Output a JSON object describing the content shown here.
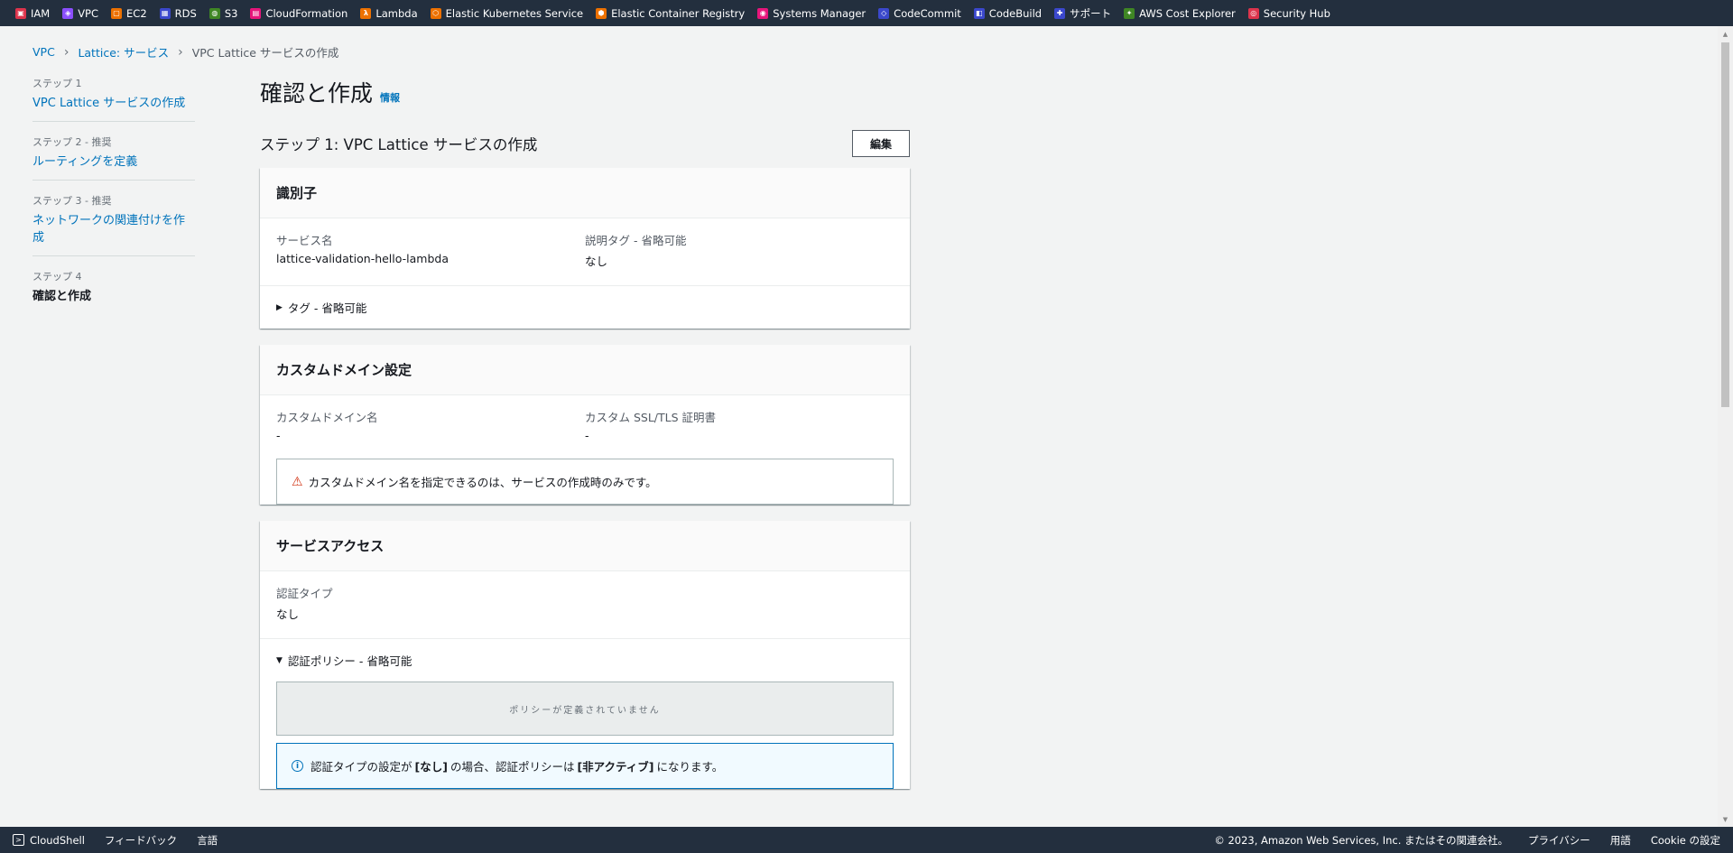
{
  "favorites": [
    {
      "label": "IAM",
      "icon": "iam-icon",
      "color": "#dd344c"
    },
    {
      "label": "VPC",
      "icon": "vpc-icon",
      "color": "#8c4fff"
    },
    {
      "label": "EC2",
      "icon": "ec2-icon",
      "color": "#ed7100"
    },
    {
      "label": "RDS",
      "icon": "rds-icon",
      "color": "#3b48cc"
    },
    {
      "label": "S3",
      "icon": "s3-icon",
      "color": "#3f8624"
    },
    {
      "label": "CloudFormation",
      "icon": "cloudformation-icon",
      "color": "#e7157b"
    },
    {
      "label": "Lambda",
      "icon": "lambda-icon",
      "color": "#ed7100"
    },
    {
      "label": "Elastic Kubernetes Service",
      "icon": "eks-icon",
      "color": "#ed7100"
    },
    {
      "label": "Elastic Container Registry",
      "icon": "ecr-icon",
      "color": "#ed7100"
    },
    {
      "label": "Systems Manager",
      "icon": "systems-manager-icon",
      "color": "#e7157b"
    },
    {
      "label": "CodeCommit",
      "icon": "codecommit-icon",
      "color": "#3b48cc"
    },
    {
      "label": "CodeBuild",
      "icon": "codebuild-icon",
      "color": "#3b48cc"
    },
    {
      "label": "サポート",
      "icon": "support-icon",
      "color": "#3b48cc"
    },
    {
      "label": "AWS Cost Explorer",
      "icon": "cost-explorer-icon",
      "color": "#3f8624"
    },
    {
      "label": "Security Hub",
      "icon": "security-hub-icon",
      "color": "#dd344c"
    }
  ],
  "breadcrumb": {
    "item1": "VPC",
    "item2": "Lattice: サービス",
    "current": "VPC Lattice サービスの作成"
  },
  "steps": [
    {
      "num": "ステップ 1",
      "label": "VPC Lattice サービスの作成"
    },
    {
      "num": "ステップ 2 - 推奨",
      "label": "ルーティングを定義"
    },
    {
      "num": "ステップ 3 - 推奨",
      "label": "ネットワークの関連付けを作成"
    },
    {
      "num": "ステップ 4",
      "label": "確認と作成"
    }
  ],
  "page": {
    "title": "確認と作成",
    "info": "情報"
  },
  "step1": {
    "title": "ステップ 1: VPC Lattice サービスの作成",
    "edit": "編集"
  },
  "identifier": {
    "title": "識別子",
    "service_name_label": "サービス名",
    "service_name_value": "lattice-validation-hello-lambda",
    "desc_tag_label": "説明タグ - 省略可能",
    "desc_tag_value": "なし",
    "tags_expander": "タグ - 省略可能"
  },
  "custom_domain": {
    "title": "カスタムドメイン設定",
    "domain_label": "カスタムドメイン名",
    "domain_value": "-",
    "cert_label": "カスタム SSL/TLS 証明書",
    "cert_value": "-",
    "warning": "カスタムドメイン名を指定できるのは、サービスの作成時のみです。"
  },
  "service_access": {
    "title": "サービスアクセス",
    "auth_type_label": "認証タイプ",
    "auth_type_value": "なし",
    "policy_expander": "認証ポリシー - 省略可能",
    "policy_empty": "ポリシーが定義されていません",
    "info_pre": "認証タイプの設定が",
    "info_b1": "[なし]",
    "info_mid": "の場合、認証ポリシーは",
    "info_b2": "[非アクティブ]",
    "info_post": "になります。"
  },
  "footer": {
    "cloudshell": "CloudShell",
    "feedback": "フィードバック",
    "language": "言語",
    "copyright": "© 2023, Amazon Web Services, Inc. またはその関連会社。",
    "privacy": "プライバシー",
    "terms": "用語",
    "cookie": "Cookie の設定"
  }
}
